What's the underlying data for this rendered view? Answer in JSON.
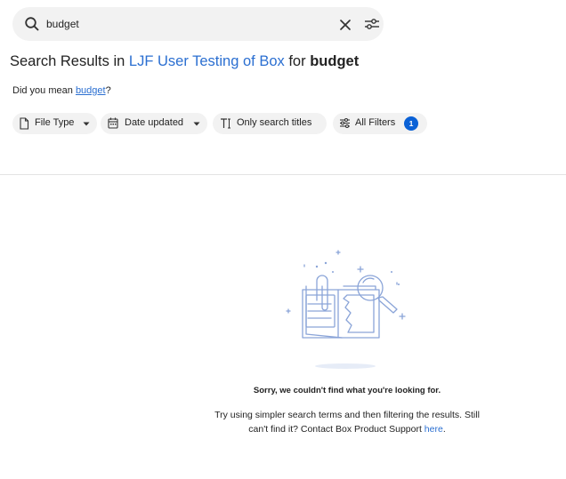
{
  "search": {
    "value": "budget"
  },
  "heading": {
    "prefix": "Search Results in ",
    "location": "LJF User Testing of Box",
    "connector": " for ",
    "query": "budget"
  },
  "suggestion": {
    "prefix": "Did you mean ",
    "term": "budget",
    "suffix": "?"
  },
  "filters": {
    "file_type": "File Type",
    "date_updated": "Date updated",
    "only_titles": "Only search titles",
    "all_filters": "All Filters",
    "all_filters_count": "1"
  },
  "empty_state": {
    "title": "Sorry, we couldn't find what you're looking for.",
    "body": "Try using simpler search terms and then filtering the results. Still can't find it? Contact Box Product Support ",
    "link": "here",
    "end": "."
  },
  "colors": {
    "accent": "#2b6fd1",
    "badge": "#0a61d6",
    "pill_bg": "#f2f2f2",
    "illustration": "#8aa4d8"
  },
  "icons": {
    "search": "search-icon",
    "clear": "close-icon",
    "options": "sliders-icon",
    "file": "file-icon",
    "calendar": "calendar-icon",
    "text": "text-icon",
    "filter": "filter-icon",
    "caret": "caret-down-icon"
  }
}
